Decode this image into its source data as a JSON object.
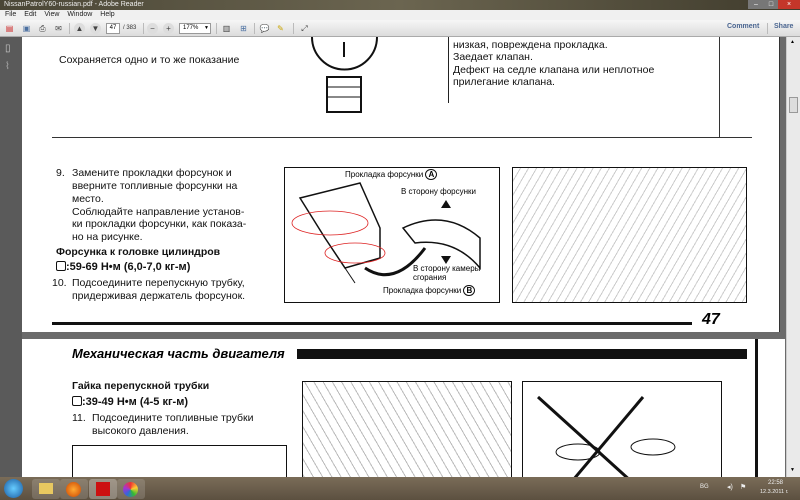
{
  "window": {
    "title": "NissanPatrolY60-russian.pdf - Adobe Reader"
  },
  "menu": [
    "File",
    "Edit",
    "View",
    "Window",
    "Help"
  ],
  "toolbar": {
    "page_current": "47",
    "page_total": "/ 383",
    "zoom": "177%",
    "comment": "Comment",
    "share": "Share"
  },
  "page1": {
    "top_left": "Сохраняется одно и то же показание",
    "top_right": [
      "низкая, повреждена прокладка.",
      "Заедает клапан.",
      "Дефект на седле клапана или неплотное",
      "прилегание клапана."
    ],
    "step9": {
      "num": "9.",
      "lines": [
        "Замените прокладки форсунок и",
        "вверните топливные форсунки на",
        "место.",
        "Соблюдайте направление установ-",
        "ки прокладки форсунки, как показа-",
        "но на рисунке."
      ]
    },
    "torque_heading": "Форсунка к головке цилиндров",
    "torque_value": ":59-69 Н•м (6,0-7,0 кг-м)",
    "step10": {
      "num": "10.",
      "lines": [
        "Подсоедините перепускную трубку,",
        "придерживая держатель форсунок."
      ]
    },
    "figure": {
      "label_a": "Прокладка форсунки",
      "a": "A",
      "to_injector": "В сторону форсунки",
      "to_chamber": [
        "В сторону камеры",
        "сгорания"
      ],
      "label_b": "Прокладка форсунки",
      "b": "B"
    },
    "page_number": "47"
  },
  "page2": {
    "header": "Механическая часть двигателя",
    "nut_heading": "Гайка перепускной трубки",
    "torque_value": ":39-49 Н•м (4-5 кг-м)",
    "step11": {
      "num": "11.",
      "lines": [
        "Подсоедините топливные трубки",
        "высокого давления."
      ]
    }
  },
  "tray": {
    "lang": "BG",
    "time": "22:58",
    "date": "12.3.2011 г."
  }
}
